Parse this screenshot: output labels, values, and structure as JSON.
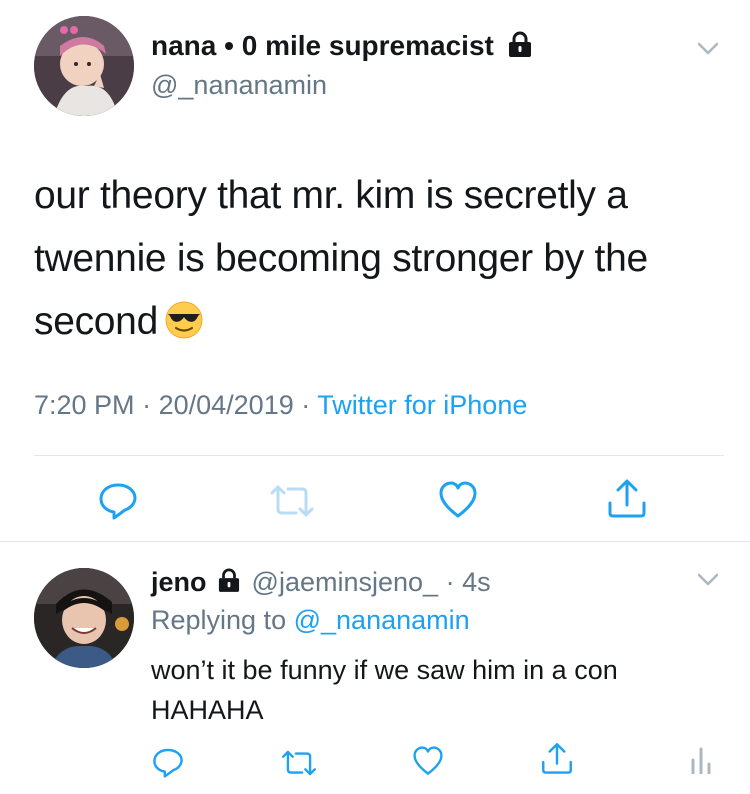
{
  "tweet": {
    "display_name": "nana • 0 mile supremacist",
    "handle": "@_nananamin",
    "text_line1": "our theory that mr. kim is secretly a",
    "text_line2": "twennie is becoming stronger by the",
    "text_line3": "second",
    "emoji": "smiling-face-with-sunglasses",
    "time": "7:20 PM",
    "date": "20/04/2019",
    "separator": "·",
    "source": "Twitter for iPhone"
  },
  "reply": {
    "display_name": "jeno",
    "handle": "@jaeminsjeno_",
    "age": "· 4s",
    "replying_prefix": "Replying to",
    "replying_to": "@_nananamin",
    "text_line1": "won’t it be funny if we saw him in a con",
    "text_line2": "HAHAHA"
  },
  "colors": {
    "text": "#14171a",
    "muted": "#657786",
    "link": "#1da1f2",
    "icon": "#1da1f2",
    "divider": "#e1e8ed"
  },
  "icons": [
    "chevron-down-icon",
    "lock-icon",
    "reply-icon",
    "retweet-icon",
    "like-icon",
    "share-icon",
    "analytics-icon"
  ]
}
